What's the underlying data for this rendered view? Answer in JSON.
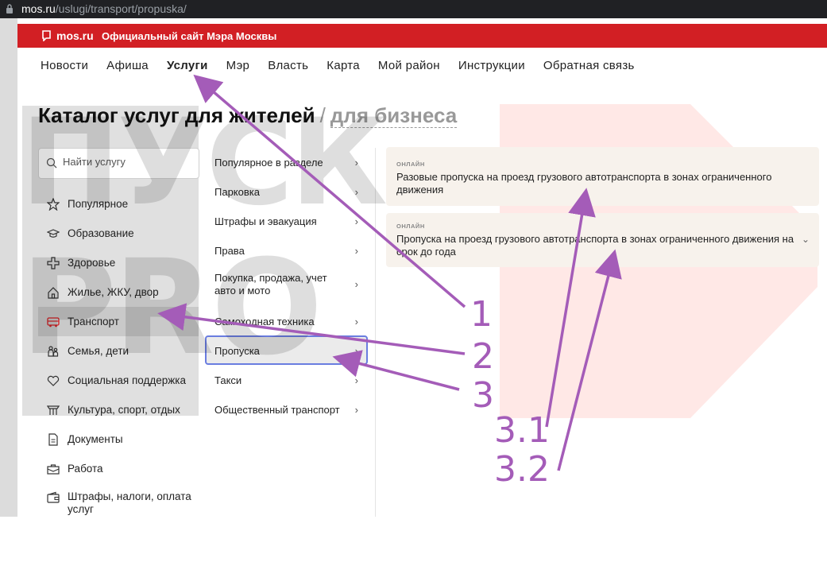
{
  "browser": {
    "url_host": "mos.ru",
    "url_path": "/uslugi/transport/propuska/"
  },
  "header": {
    "brand": "mos.ru",
    "tagline": "Официальный сайт Мэра Москвы",
    "color": "#d21f24"
  },
  "nav": {
    "items": [
      {
        "label": "Новости"
      },
      {
        "label": "Афиша"
      },
      {
        "label": "Услуги",
        "active": true
      },
      {
        "label": "Мэр"
      },
      {
        "label": "Власть"
      },
      {
        "label": "Карта"
      },
      {
        "label": "Мой район"
      },
      {
        "label": "Инструкции"
      },
      {
        "label": "Обратная связь"
      }
    ]
  },
  "catalog": {
    "title": "Каталог услуг для жителей",
    "separator": "/",
    "alt": "для бизнеса"
  },
  "search": {
    "placeholder": "Найти услугу"
  },
  "categories": [
    {
      "label": "Популярное",
      "icon": "star-icon"
    },
    {
      "label": "Образование",
      "icon": "graduation-cap-icon"
    },
    {
      "label": "Здоровье",
      "icon": "medical-cross-icon"
    },
    {
      "label": "Жилье, ЖКУ, двор",
      "icon": "house-icon"
    },
    {
      "label": "Транспорт",
      "icon": "bus-icon",
      "active": true
    },
    {
      "label": "Семья, дети",
      "icon": "family-icon"
    },
    {
      "label": "Социальная поддержка",
      "icon": "heart-icon"
    },
    {
      "label": "Культура, спорт, отдых",
      "icon": "theater-icon"
    },
    {
      "label": "Документы",
      "icon": "document-icon"
    },
    {
      "label": "Работа",
      "icon": "briefcase-icon"
    },
    {
      "label": "Штрафы, налоги, оплата услуг",
      "icon": "wallet-icon"
    }
  ],
  "subcategories": [
    {
      "label": "Популярное в разделе"
    },
    {
      "label": "Парковка"
    },
    {
      "label": "Штрафы и эвакуация"
    },
    {
      "label": "Права"
    },
    {
      "label": "Покупка, продажа, учет авто и мото"
    },
    {
      "label": "Самоходная техника"
    },
    {
      "label": "Пропуска",
      "active": true
    },
    {
      "label": "Такси"
    },
    {
      "label": "Общественный транспорт"
    }
  ],
  "services": [
    {
      "tag": "ОНЛАЙН",
      "title": "Разовые пропуска на проезд грузового автотранспорта в зонах ограниченного движения"
    },
    {
      "tag": "ОНЛАЙН",
      "title": "Пропуска на проезд грузового автотранспорта в зонах ограниченного движения на срок до года"
    }
  ],
  "watermark": {
    "line1": "ПУСК",
    "line2": "PRO"
  },
  "annotations": {
    "color": "#a45cb8",
    "labels": [
      "1",
      "2",
      "3",
      "3.1",
      "3.2"
    ]
  }
}
